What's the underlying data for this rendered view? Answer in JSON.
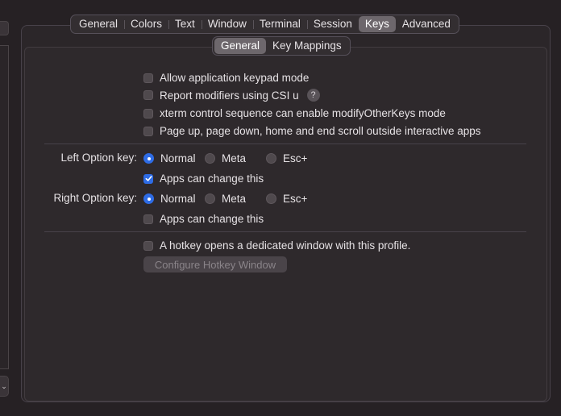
{
  "profile_tabs": [
    "General",
    "Colors",
    "Text",
    "Window",
    "Terminal",
    "Session",
    "Keys",
    "Advanced"
  ],
  "profile_tabs_active": "Keys",
  "sub_tabs": [
    "General",
    "Key Mappings"
  ],
  "sub_tabs_active": "General",
  "options": {
    "keypad": {
      "label": "Allow application keypad mode",
      "checked": false
    },
    "csi_u": {
      "label": "Report modifiers using CSI u",
      "checked": false,
      "help": "?"
    },
    "xterm": {
      "label": "xterm control sequence can enable modifyOtherKeys mode",
      "checked": false
    },
    "page_scroll": {
      "label": "Page up, page down, home and end scroll outside interactive apps",
      "checked": false
    }
  },
  "left_option": {
    "label": "Left Option key:",
    "choices": [
      "Normal",
      "Meta",
      "Esc+"
    ],
    "selected": "Normal",
    "apps_change": {
      "label": "Apps can change this",
      "checked": true
    }
  },
  "right_option": {
    "label": "Right Option key:",
    "choices": [
      "Normal",
      "Meta",
      "Esc+"
    ],
    "selected": "Normal",
    "apps_change": {
      "label": "Apps can change this",
      "checked": false
    }
  },
  "hotkey": {
    "label": "A hotkey opens a dedicated window with this profile.",
    "checked": false,
    "button_label": "Configure Hotkey Window"
  },
  "left_stub_glyph": "⌄",
  "colors": {
    "accent": "#2e6ce6",
    "background": "#262124",
    "panel": "#2e292c"
  }
}
